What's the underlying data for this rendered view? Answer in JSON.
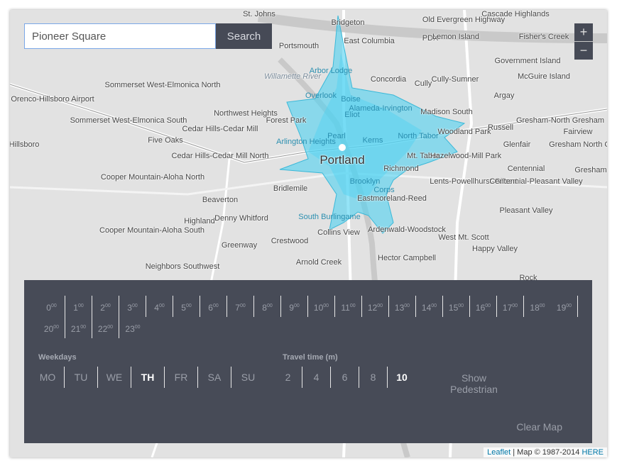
{
  "search": {
    "value": "Pioneer Square",
    "button_label": "Search"
  },
  "zoom": {
    "in_label": "+",
    "out_label": "−"
  },
  "map_labels": [
    "St. Johns",
    "Bridgeton",
    "Old Evergreen Highway",
    "Cascade Highlands",
    "Portsmouth",
    "East Columbia",
    "PDX",
    "Lemon Island",
    "Fisher's Creek",
    "Willamette River",
    "Arbor Lodge",
    "Concordia",
    "Cully",
    "Cully-Sumner",
    "Government Island",
    "McGuire Island",
    "Sommerset West-Elmonica North",
    "Overlook",
    "Boise",
    "Argay",
    "Orenco-Hillsboro Airport",
    "Northwest Heights",
    "Forest Park",
    "Eliot",
    "Alameda-Irvington",
    "Madison South",
    "Gresham-North Gresham",
    "Sommerset West-Elmonica South",
    "Cedar Hills-Cedar Mill",
    "Pearl",
    "Kerns",
    "North Tabor",
    "Woodland Park",
    "Russell",
    "Fairview",
    "Hillsboro",
    "Five Oaks",
    "Arlington Heights",
    "Glenfair",
    "Gresham North Central",
    "Cedar Hills-Cedar Mill North",
    "Mt. Tabor",
    "Hazelwood-Mill Park",
    "Cooper Mountain-Aloha North",
    "Richmond",
    "Centennial",
    "Gresham",
    "Bridlemile",
    "Brooklyn",
    "Corps",
    "Lents-Powellhurst-Gilbert",
    "Centennial-Pleasant Valley",
    "Beaverton",
    "Eastmoreland-Reed",
    "Highland",
    "Denny Whitford",
    "Pleasant Valley",
    "South Burlingame",
    "Collins View",
    "Ardenwald-Woodstock",
    "Cooper Mountain-Aloha South",
    "Greenway",
    "Crestwood",
    "West Mt. Scott",
    "Happy Valley",
    "Neighbors Southwest",
    "Arnold Creek",
    "Hector Campbell",
    "Rock",
    "Portland"
  ],
  "hours": [
    "0",
    "1",
    "2",
    "3",
    "4",
    "5",
    "6",
    "7",
    "8",
    "9",
    "10",
    "11",
    "12",
    "13",
    "14",
    "15",
    "16",
    "17",
    "18",
    "19",
    "20",
    "21",
    "22",
    "23"
  ],
  "hour_suffix": "00",
  "weekdays": {
    "title": "Weekdays",
    "items": [
      "MO",
      "TU",
      "WE",
      "TH",
      "FR",
      "SA",
      "SU"
    ],
    "selected": "TH"
  },
  "travel_time": {
    "title": "Travel time (m)",
    "items": [
      "2",
      "4",
      "6",
      "8",
      "10"
    ],
    "selected": "10"
  },
  "show_pedestrian": {
    "line1": "Show",
    "line2": "Pedestrian"
  },
  "clear_map_label": "Clear Map",
  "attribution": {
    "leaflet": "Leaflet",
    "text": " | Map © 1987-2014 ",
    "here": "HERE"
  },
  "colors": {
    "panel": "#474b57",
    "isochrone": "#4fd2f2",
    "map_bg": "#e2e2e2"
  }
}
